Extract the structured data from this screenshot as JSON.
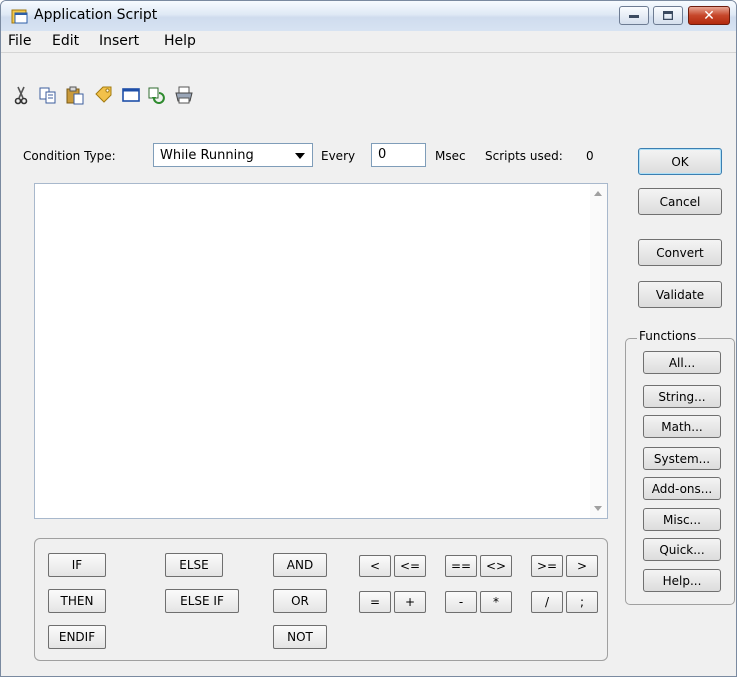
{
  "window": {
    "title": "Application Script",
    "close_glyph": "✕"
  },
  "menu": [
    "File",
    "Edit",
    "Insert",
    "Help"
  ],
  "toolbar": {
    "icons": [
      "cut-icon",
      "copy-icon",
      "paste-icon",
      "tag-icon",
      "window-icon",
      "refresh-icon",
      "print-icon"
    ]
  },
  "condition": {
    "label": "Condition Type:",
    "value": "While Running",
    "every_label": "Every",
    "every_value": "0",
    "msec_label": "Msec",
    "scripts_used_label": "Scripts used:",
    "scripts_used_value": "0"
  },
  "actions": {
    "ok": "OK",
    "cancel": "Cancel",
    "convert": "Convert",
    "validate": "Validate"
  },
  "functions": {
    "label": "Functions",
    "buttons": [
      "All...",
      "String...",
      "Math...",
      "System...",
      "Add-ons...",
      "Misc...",
      "Quick...",
      "Help..."
    ]
  },
  "keypad": {
    "if": "IF",
    "else": "ELSE",
    "and": "AND",
    "then": "THEN",
    "else_if": "ELSE IF",
    "or": "OR",
    "endif": "ENDIF",
    "not": "NOT",
    "lt": "<",
    "le": "<=",
    "eq": "==",
    "ne": "<>",
    "ge": ">=",
    "gt": ">",
    "assign": "=",
    "plus": "+",
    "minus": "-",
    "times": "*",
    "divide": "/",
    "semicolon": ";"
  }
}
